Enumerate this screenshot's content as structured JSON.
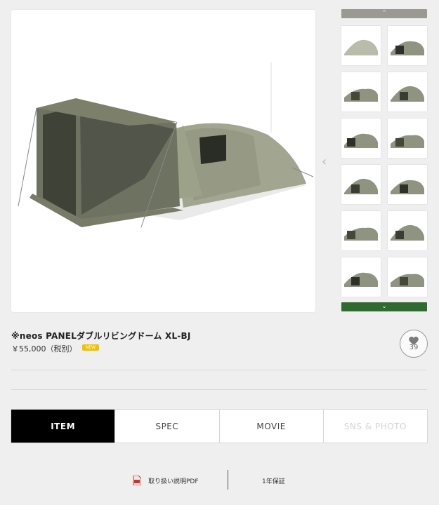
{
  "product": {
    "title": "※neos PANELダブルリビングドーム XL-BJ",
    "price": "￥55,000（税別）",
    "badge": "NEW",
    "favorite_count": "39"
  },
  "thumbnails": {
    "up_arrow": "⌃",
    "down_arrow": "⌄",
    "count": 12
  },
  "gallery": {
    "prev_arrow": "‹"
  },
  "tabs": [
    {
      "label": "ITEM",
      "state": "active"
    },
    {
      "label": "SPEC",
      "state": "normal"
    },
    {
      "label": "MOVIE",
      "state": "normal"
    },
    {
      "label": "SNS & PHOTO",
      "state": "disabled"
    }
  ],
  "footer": {
    "pdf_label": "取り扱い説明PDF",
    "warranty_label": "1年保証"
  },
  "colors": {
    "accent_green": "#2f6a2e",
    "badge_yellow": "#f2c200",
    "tent_olive": "#8a8f7a"
  }
}
